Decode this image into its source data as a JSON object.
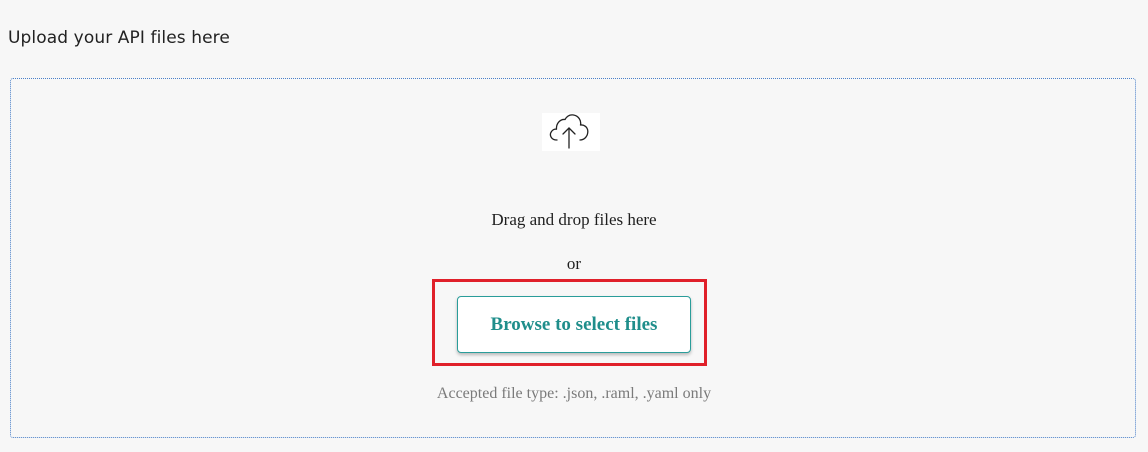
{
  "page": {
    "title": "Upload your API files here"
  },
  "dropzone": {
    "icon": "cloud-upload-icon",
    "drag_text": "Drag and drop files here",
    "or_text": "or",
    "browse_label": "Browse to select files",
    "accepted_text": "Accepted file type: .json, .raml, .yaml only"
  },
  "colors": {
    "accent": "#1f8e8b",
    "highlight": "#e0202a",
    "dropzone_border": "#4a80c9"
  }
}
